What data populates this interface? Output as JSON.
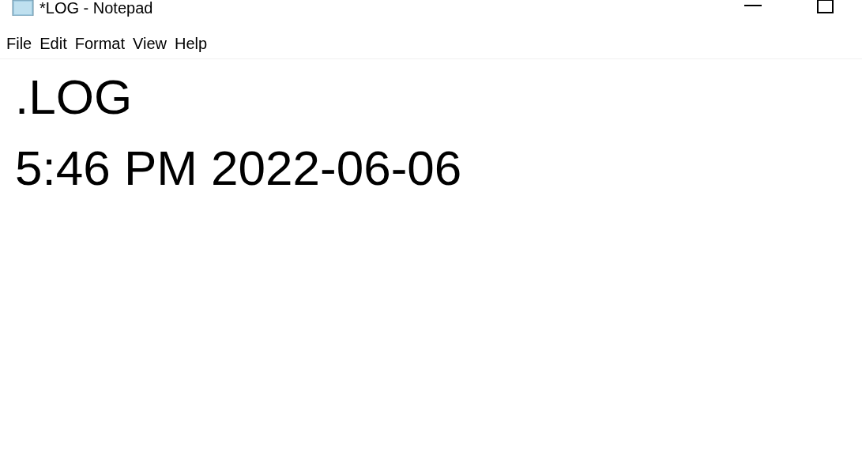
{
  "window": {
    "title": "*LOG - Notepad"
  },
  "menu": [
    "File",
    "Edit",
    "Format",
    "View",
    "Help"
  ],
  "editor": {
    "lines": [
      ".LOG",
      "5:46 PM 2022-06-06"
    ]
  }
}
